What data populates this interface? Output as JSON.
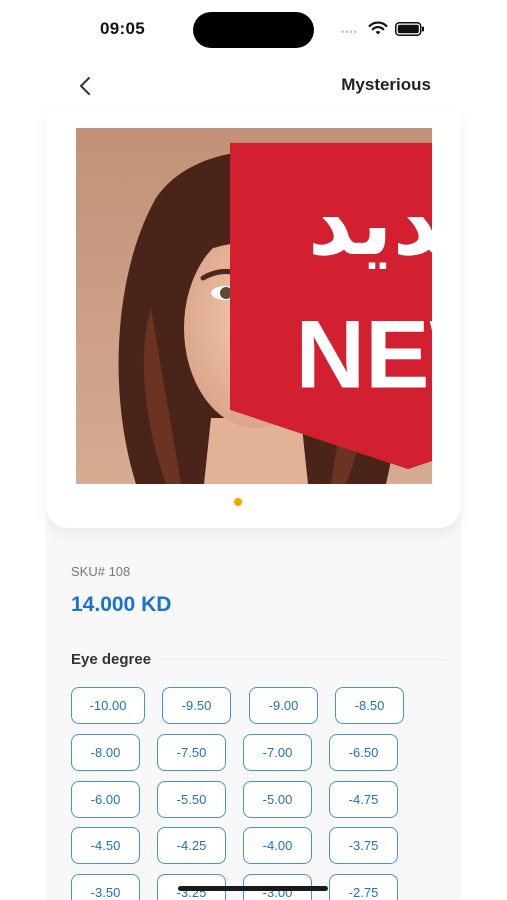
{
  "status_bar": {
    "time": "09:05",
    "signal_dots": "••••"
  },
  "nav": {
    "title": "Mysterious"
  },
  "product": {
    "badge_ar": "جديد",
    "badge_en": "NEW",
    "sku": "SKU# 108",
    "price": "14.000 KD"
  },
  "eye_degree": {
    "title": "Eye degree",
    "options": [
      "-10.00",
      "-9.50",
      "-9.00",
      "-8.50",
      "-8.00",
      "-7.50",
      "-7.00",
      "-6.50",
      "-6.00",
      "-5.50",
      "-5.00",
      "-4.75",
      "-4.50",
      "-4.25",
      "-4.00",
      "-3.75",
      "-3.50",
      "-3.25",
      "-3.00",
      "-2.75"
    ]
  },
  "colors": {
    "accent": "#1a73d1",
    "chip_border": "#4a90e2",
    "dot": "#f0a800",
    "badge": "#d32030"
  },
  "icons": {
    "back": "chevron-left-icon",
    "wifi": "wifi-icon",
    "battery": "battery-icon"
  }
}
